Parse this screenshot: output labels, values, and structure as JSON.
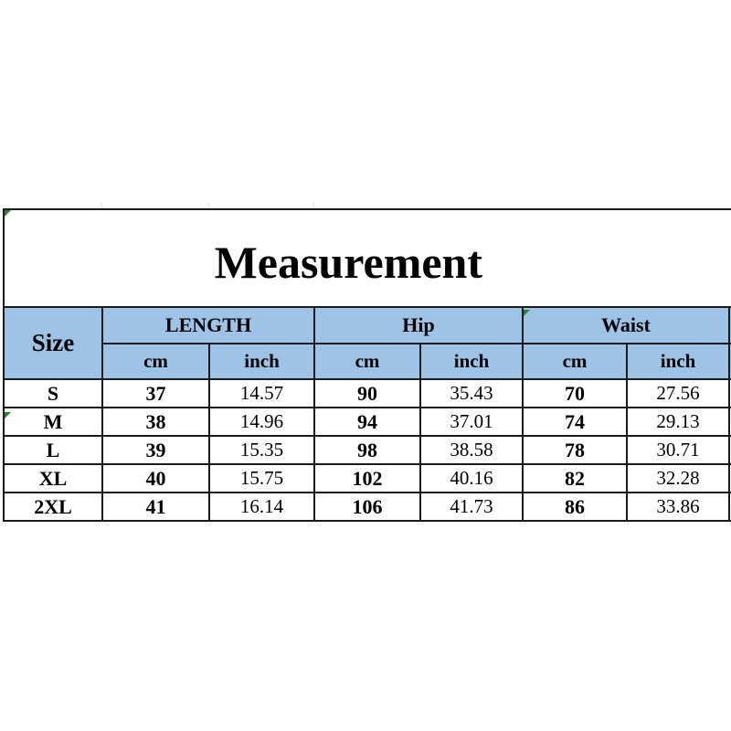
{
  "title": "Measurement",
  "header": {
    "size_label": "Size",
    "groups": [
      "LENGTH",
      "Hip",
      "Waist"
    ],
    "units": [
      "cm",
      "inch",
      "cm",
      "inch",
      "cm",
      "inch"
    ]
  },
  "rows": [
    {
      "size": "S",
      "length_cm": "37",
      "length_inch": "14.57",
      "hip_cm": "90",
      "hip_inch": "35.43",
      "waist_cm": "70",
      "waist_inch": "27.56"
    },
    {
      "size": "M",
      "length_cm": "38",
      "length_inch": "14.96",
      "hip_cm": "94",
      "hip_inch": "37.01",
      "waist_cm": "74",
      "waist_inch": "29.13"
    },
    {
      "size": "L",
      "length_cm": "39",
      "length_inch": "15.35",
      "hip_cm": "98",
      "hip_inch": "38.58",
      "waist_cm": "78",
      "waist_inch": "30.71"
    },
    {
      "size": "XL",
      "length_cm": "40",
      "length_inch": "15.75",
      "hip_cm": "102",
      "hip_inch": "40.16",
      "waist_cm": "82",
      "waist_inch": "32.28"
    },
    {
      "size": "2XL",
      "length_cm": "41",
      "length_inch": "16.14",
      "hip_cm": "106",
      "hip_inch": "41.73",
      "waist_cm": "86",
      "waist_inch": "33.86"
    }
  ],
  "colors": {
    "header_fill": "#9dc3e6",
    "border": "#1a1a1a",
    "cell_marker": "#1e8a1e"
  }
}
